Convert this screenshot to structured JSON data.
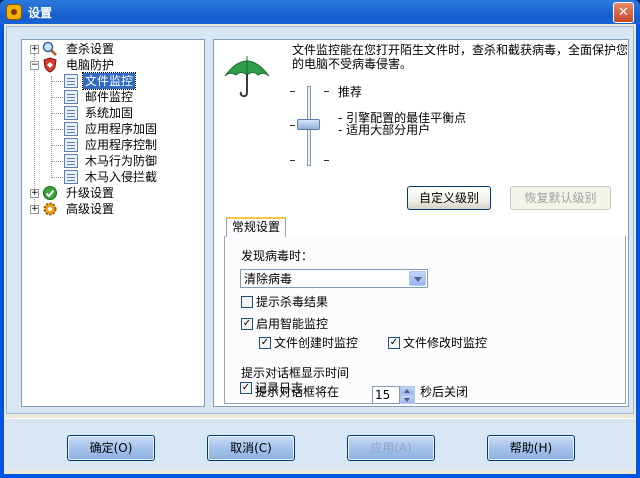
{
  "window": {
    "title": "设置",
    "close_glyph": "✕"
  },
  "tree": {
    "items": [
      {
        "label": "查杀设置",
        "icon": "search-icon",
        "expander": "+"
      },
      {
        "label": "电脑防护",
        "icon": "shield-icon",
        "expander": "−"
      },
      {
        "label": "文件监控",
        "icon": "document-icon",
        "selected": true
      },
      {
        "label": "邮件监控",
        "icon": "document-icon"
      },
      {
        "label": "系统加固",
        "icon": "document-icon"
      },
      {
        "label": "应用程序加固",
        "icon": "document-icon"
      },
      {
        "label": "应用程序控制",
        "icon": "document-icon"
      },
      {
        "label": "木马行为防御",
        "icon": "document-icon"
      },
      {
        "label": "木马入侵拦截",
        "icon": "document-icon"
      },
      {
        "label": "升级设置",
        "icon": "update-icon",
        "expander": "+"
      },
      {
        "label": "高级设置",
        "icon": "gear-icon",
        "expander": "+"
      }
    ]
  },
  "main": {
    "description": "文件监控能在您打开陌生文件时，查杀和截获病毒，全面保护您的电脑不受病毒侵害。",
    "levels": {
      "recommended": "推荐",
      "engine_line": "- 引擎配置的最佳平衡点",
      "users_line": "- 适用大部分用户"
    },
    "custom_level_button": "自定义级别",
    "restore_default_button": "恢复默认级别",
    "tab_label": "常规设置",
    "on_virus_found_label": "发现病毒时：",
    "action_select_value": "清除病毒",
    "show_result_label": "提示杀毒结果",
    "show_result_checked": false,
    "smart_monitor_label": "启用智能监控",
    "smart_monitor_checked": true,
    "file_create_label": "文件创建时监控",
    "file_create_checked": true,
    "file_modify_label": "文件修改时监控",
    "file_modify_checked": true,
    "dialog_time_heading": "提示对话框显示时间",
    "dialog_prefix": "提示对话框将在",
    "dialog_seconds": "15",
    "dialog_suffix": "秒后关闭",
    "log_label": "记录日志",
    "log_checked": true
  },
  "footer": {
    "ok": "确定(O)",
    "cancel": "取消(C)",
    "apply": "应用(A)",
    "help": "帮助(H)"
  },
  "colors": {
    "titlebar": "#1f6ad6",
    "selection": "#316ac5",
    "panel_bg": "#d9e6f4",
    "checkmark": "#21a121"
  }
}
